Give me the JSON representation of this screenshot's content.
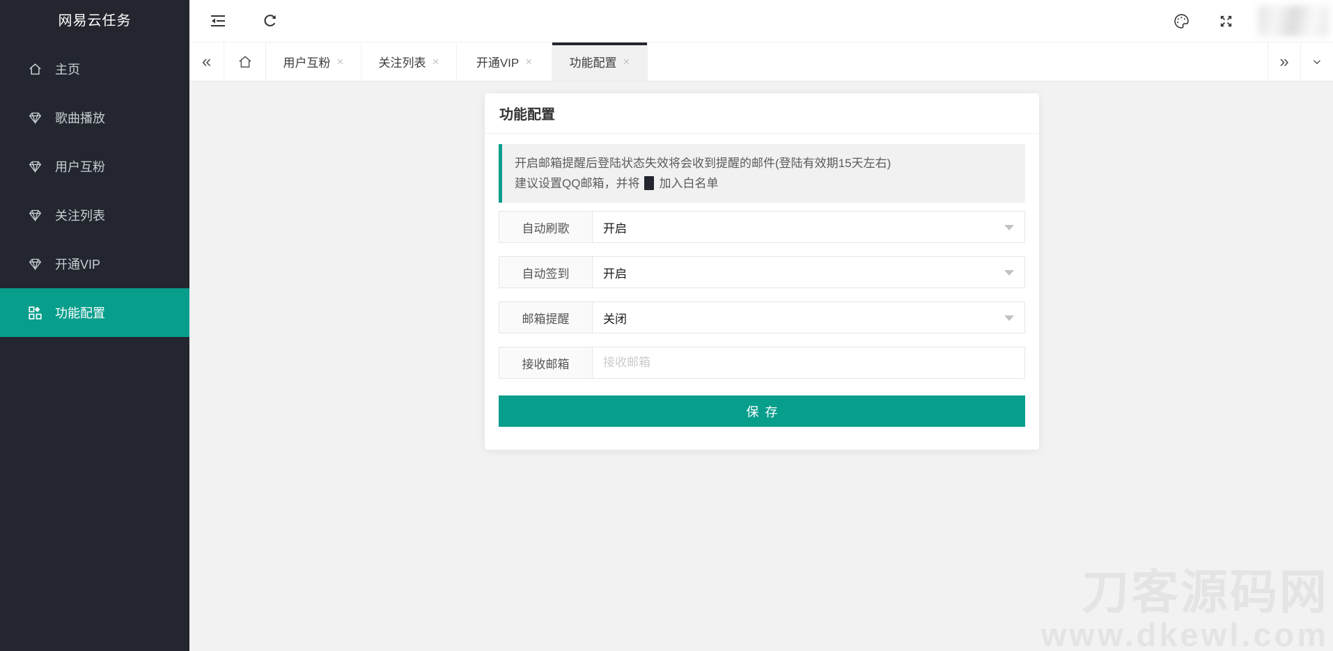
{
  "colors": {
    "accent": "#089e8c",
    "sidebar_bg": "#23262e",
    "content_bg": "#f2f2f2",
    "active_tab_bar": "#23262e"
  },
  "sidebar": {
    "title": "网易云任务",
    "items": [
      {
        "label": "主页",
        "icon": "home-icon",
        "active": false
      },
      {
        "label": "歌曲播放",
        "icon": "gem-icon",
        "active": false
      },
      {
        "label": "用户互粉",
        "icon": "gem-icon",
        "active": false
      },
      {
        "label": "关注列表",
        "icon": "gem-icon",
        "active": false
      },
      {
        "label": "开通VIP",
        "icon": "gem-icon",
        "active": false
      },
      {
        "label": "功能配置",
        "icon": "grid-icon",
        "active": true
      }
    ]
  },
  "header": {
    "icons": [
      "fold-icon",
      "refresh-icon",
      "palette-icon",
      "fullscreen-icon"
    ]
  },
  "tabbar": {
    "collapse_left_glyph": "«",
    "expand_right_glyph": "»",
    "close_glyph": "×",
    "tabs": [
      {
        "label": "用户互粉",
        "active": false
      },
      {
        "label": "关注列表",
        "active": false
      },
      {
        "label": "开通VIP",
        "active": false
      },
      {
        "label": "功能配置",
        "active": true
      }
    ]
  },
  "panel": {
    "title": "功能配置",
    "notice_line1": "开启邮箱提醒后登陆状态失效将会收到提醒的邮件(登陆有效期15天左右)",
    "notice_line2_prefix": "建议设置QQ邮箱，并将",
    "notice_line2_suffix": "加入白名单",
    "fields": [
      {
        "label": "自动刷歌",
        "value": "开启",
        "type": "select"
      },
      {
        "label": "自动签到",
        "value": "开启",
        "type": "select"
      },
      {
        "label": "邮箱提醒",
        "value": "关闭",
        "type": "select"
      },
      {
        "label": "接收邮箱",
        "value": "",
        "placeholder": "接收邮箱",
        "type": "input"
      }
    ],
    "save_label": "保存"
  },
  "watermark": {
    "line1": "刀客源码网",
    "line2": "www.dkewl.com"
  }
}
